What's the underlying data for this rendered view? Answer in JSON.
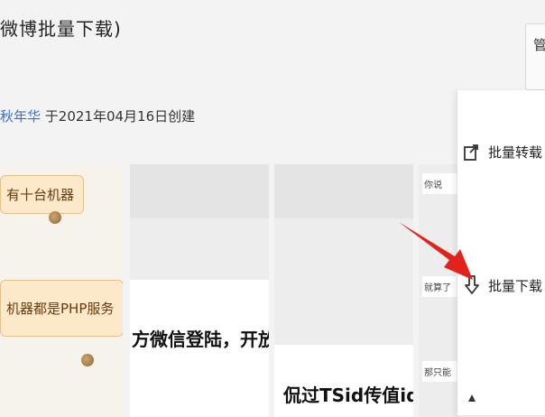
{
  "header": {
    "title": "微博批量下载)",
    "author_link": "秋年华",
    "created_text": "于2021年04月16日创建",
    "side_button_text": "管"
  },
  "thumbnails": {
    "t1": {
      "pill1": "有十台机器",
      "pill2": "机器都是PHP服务"
    },
    "t2": {
      "text": "方微信登陆，开放平台"
    },
    "t3": {
      "text": "侃过TSid传值id－"
    },
    "t4": {
      "mini1": "你说",
      "mini2": "就算了",
      "mini3": "那只能"
    }
  },
  "menu": {
    "items": [
      {
        "label": "批量转载",
        "icon": "share-export-icon"
      },
      {
        "label": "批量下载",
        "icon": "download-icon"
      },
      {
        "label": "",
        "icon": "more-icon"
      }
    ]
  },
  "annotation": {
    "arrow_color": "#e3221d"
  }
}
